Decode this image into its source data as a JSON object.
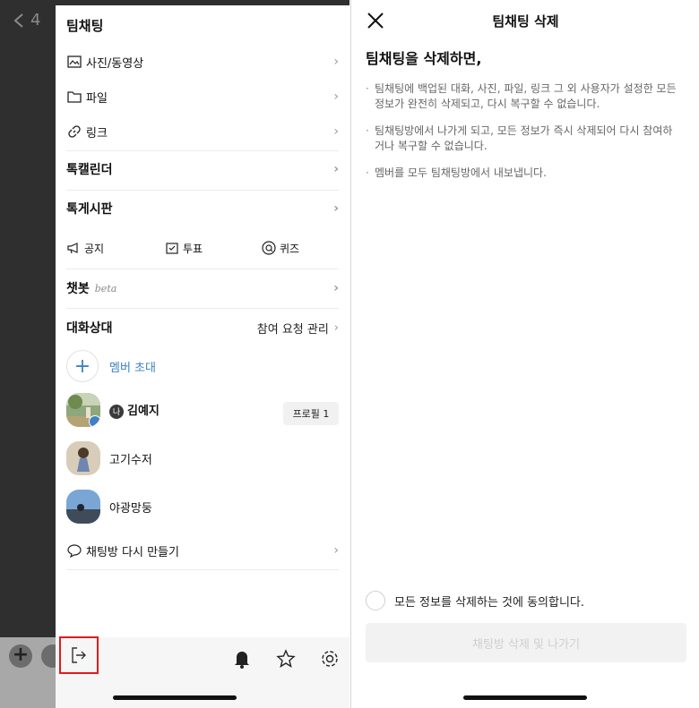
{
  "left": {
    "back_count": "4",
    "dim_plus": "+",
    "drawer_title": "팀채팅",
    "media": {
      "photos": "사진/동영상",
      "files": "파일",
      "links": "링크"
    },
    "calendar": "톡캘린더",
    "board": "톡게시판",
    "tools": {
      "notice": "공지",
      "vote": "투표",
      "quiz": "퀴즈"
    },
    "chatbot": "챗봇",
    "chatbot_badge": "beta",
    "members_title": "대화상대",
    "join_requests": "참여 요청 관리",
    "invite": "멤버 초대",
    "members": [
      {
        "name": "김예지",
        "me_badge": "나",
        "profile": "프로필 1"
      },
      {
        "name": "고기수저"
      },
      {
        "name": "야광망둥"
      }
    ],
    "recreate": "채팅방 다시 만들기"
  },
  "right": {
    "title": "팀채팅 삭제",
    "heading": "팀채팅을 삭제하면,",
    "items": [
      "팀채팅에 백업된 대화, 사진, 파일, 링크 그 외 사용자가 설정한 모든 정보가 완전히 삭제되고, 다시 복구할 수 없습니다.",
      "팀채팅방에서 나가게 되고, 모든 정보가 즉시 삭제되어 다시 참여하거나 복구할 수 없습니다.",
      "멤버를 모두 팀채팅방에서 내보냅니다."
    ],
    "agree_label": "모든 정보를 삭제하는 것에 동의합니다.",
    "delete_button": "채팅방 삭제 및 나가기"
  },
  "colors": {
    "accent_blue": "#3e82c5",
    "highlight_red": "#e21b1b"
  }
}
